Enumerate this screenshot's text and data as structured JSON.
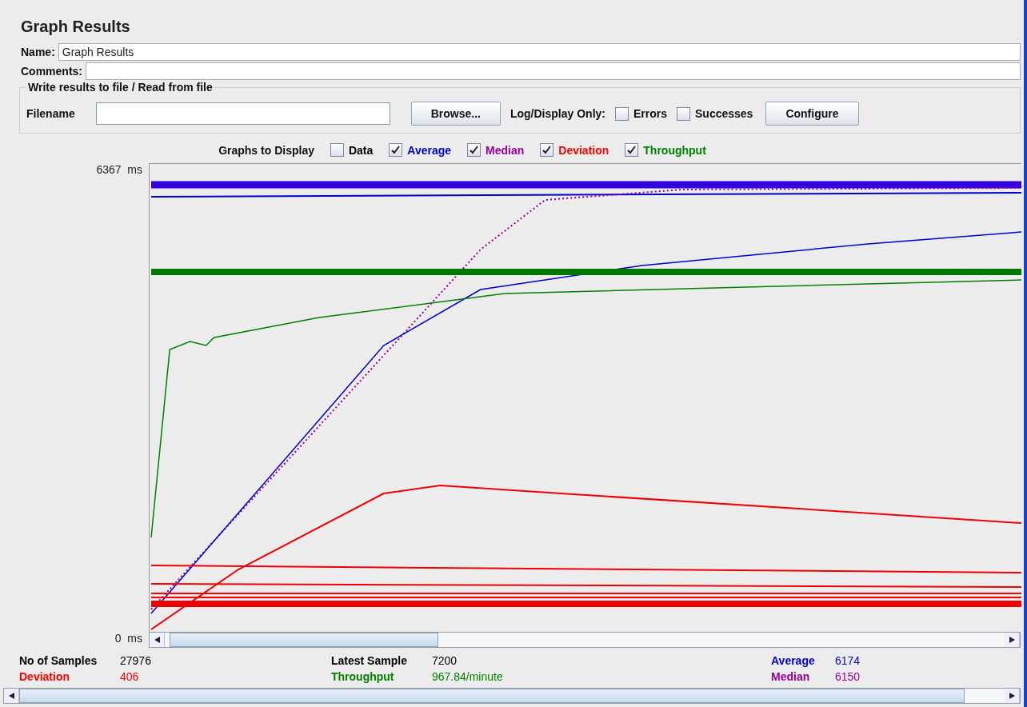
{
  "title": "Graph Results",
  "name": {
    "label": "Name:",
    "value": "Graph Results"
  },
  "comments": {
    "label": "Comments:"
  },
  "file_group": {
    "title": "Write results to file / Read from file",
    "filename_label": "Filename",
    "browse": "Browse...",
    "log_label": "Log/Display Only:",
    "options": [
      {
        "label": "Errors",
        "checked": false
      },
      {
        "label": "Successes",
        "checked": false
      }
    ],
    "configure": "Configure"
  },
  "graphs_to_display": {
    "label": "Graphs to Display",
    "items": [
      {
        "label": "Data",
        "checked": false,
        "color": "#000000"
      },
      {
        "label": "Average",
        "checked": true,
        "color": "#0000cc"
      },
      {
        "label": "Median",
        "checked": true,
        "color": "#990099"
      },
      {
        "label": "Deviation",
        "checked": true,
        "color": "#ff0000"
      },
      {
        "label": "Throughput",
        "checked": true,
        "color": "#008000"
      }
    ]
  },
  "axis": {
    "top": "6367  ms",
    "bottom": "0  ms"
  },
  "stats": [
    {
      "label": "No of Samples",
      "value": "27976",
      "color": "#000000"
    },
    {
      "label": "Latest Sample",
      "value": "7200",
      "color": "#000000"
    },
    {
      "label": "Average",
      "value": "6174",
      "color": "#0000cc"
    },
    {
      "label": "Deviation",
      "value": "406",
      "color": "#ff0000"
    },
    {
      "label": "Throughput",
      "value": "967.84/minute",
      "color": "#008000"
    },
    {
      "label": "Median",
      "value": "6150",
      "color": "#990099"
    }
  ]
}
